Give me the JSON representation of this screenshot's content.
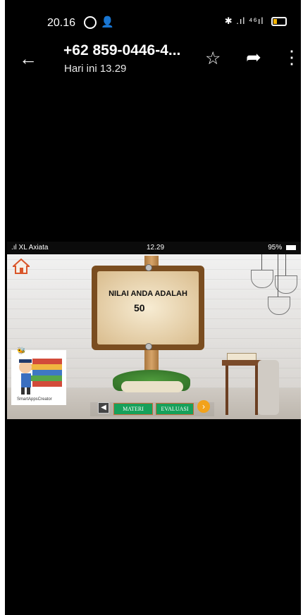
{
  "status_bar": {
    "time": "20.16",
    "right_icons": "✱ .ıl ⁴⁶ıl"
  },
  "header": {
    "title": "+62 859-0446-4...",
    "subtitle": "Hari ini 13.29",
    "back_icon": "arrow-left-icon",
    "star_icon": "star-icon",
    "share_icon": "share-icon",
    "more_icon": "more-vertical-icon"
  },
  "image": {
    "status": {
      "carrier": ".ıl XL Axiata",
      "time": "12.29",
      "battery": "95%"
    },
    "sign": {
      "label": "NILAI ANDA ADALAH",
      "score": "50"
    },
    "logo_text": "SmartAppsCreator",
    "buttons": {
      "materi": "MATERI",
      "evaluasi": "EVALUASI"
    },
    "colors": {
      "accent_orange": "#f2a21b",
      "button_green": "#17a05a"
    }
  }
}
